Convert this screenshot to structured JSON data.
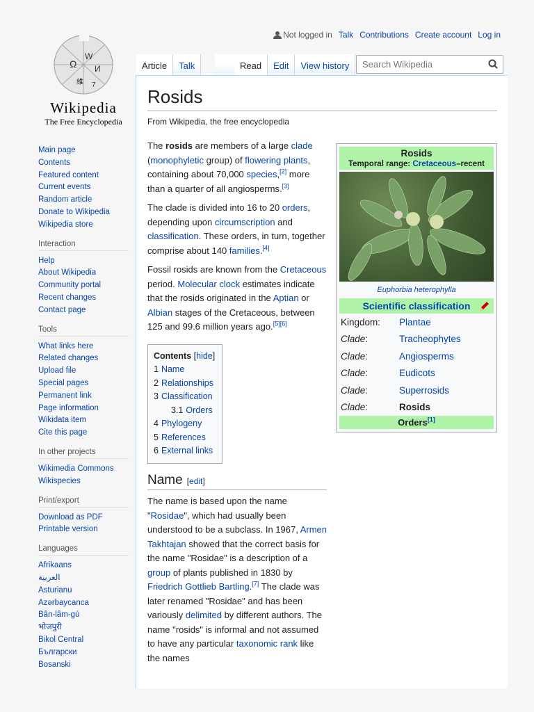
{
  "logo": {
    "wordmark": "Wikipedia",
    "tagline": "The Free Encyclopedia"
  },
  "personal": {
    "status": "Not logged in",
    "links": [
      "Talk",
      "Contributions",
      "Create account",
      "Log in"
    ]
  },
  "tabs": {
    "left": [
      "Article",
      "Talk"
    ],
    "right": [
      "Read",
      "Edit",
      "View history"
    ]
  },
  "search": {
    "placeholder": "Search Wikipedia"
  },
  "title": "Rosids",
  "subtitle": "From Wikipedia, the free encyclopedia",
  "paragraphs": [
    [
      {
        "t": "The "
      },
      {
        "t": "rosids",
        "b": 1
      },
      {
        "t": " are members of a large "
      },
      {
        "t": "clade",
        "l": 1
      },
      {
        "t": " ("
      },
      {
        "t": "monophyletic",
        "l": 1
      },
      {
        "t": " group) of "
      },
      {
        "t": "flowering plants",
        "l": 1
      },
      {
        "t": ", containing about 70,000 "
      },
      {
        "t": "species",
        "l": 1
      },
      {
        "t": ",",
        "n": 0
      },
      {
        "t": "[2]",
        "s": 1
      },
      {
        "t": " more than a quarter of all angiosperms."
      },
      {
        "t": "[3]",
        "s": 1
      }
    ],
    [
      {
        "t": "The clade is divided into 16 to 20 "
      },
      {
        "t": "orders",
        "l": 1
      },
      {
        "t": ", depending upon "
      },
      {
        "t": "circumscription",
        "l": 1
      },
      {
        "t": " and "
      },
      {
        "t": "classification",
        "l": 1
      },
      {
        "t": ". These orders, in turn, together comprise about 140 "
      },
      {
        "t": "families",
        "l": 1
      },
      {
        "t": "."
      },
      {
        "t": "[4]",
        "s": 1
      }
    ],
    [
      {
        "t": "Fossil rosids are known from the "
      },
      {
        "t": "Cretaceous",
        "l": 1
      },
      {
        "t": " period. "
      },
      {
        "t": "Molecular clock",
        "l": 1
      },
      {
        "t": " estimates indicate that the rosids originated in the "
      },
      {
        "t": "Aptian",
        "l": 1
      },
      {
        "t": " or "
      },
      {
        "t": "Albian",
        "l": 1
      },
      {
        "t": " stages of the Cretaceous, between 125 and 99.6 million years ago."
      },
      {
        "t": "[5][6]",
        "s": 1
      }
    ]
  ],
  "toc": {
    "title": "Contents",
    "hide": "hide",
    "items": [
      {
        "n": "1",
        "t": "Name"
      },
      {
        "n": "2",
        "t": "Relationships"
      },
      {
        "n": "3",
        "t": "Classification"
      },
      {
        "n": "3.1",
        "t": "Orders",
        "sub": 1
      },
      {
        "n": "4",
        "t": "Phylogeny"
      },
      {
        "n": "5",
        "t": "References"
      },
      {
        "n": "6",
        "t": "External links"
      }
    ]
  },
  "name_section": {
    "heading": "Name",
    "edit": "edit",
    "paragraph": [
      {
        "t": "The name is based upon the name \""
      },
      {
        "t": "Rosidae",
        "l": 1
      },
      {
        "t": "\", which had usually been understood to be a subclass. In 1967, "
      },
      {
        "t": "Armen Takhtajan",
        "l": 1
      },
      {
        "t": " showed that the correct basis for the name \"Rosidae\" is a description of a "
      },
      {
        "t": "group",
        "l": 1
      },
      {
        "t": " of plants published in 1830 by "
      },
      {
        "t": "Friedrich Gottlieb Bartling",
        "l": 1
      },
      {
        "t": "."
      },
      {
        "t": "[7]",
        "s": 1
      },
      {
        "t": " The clade was later renamed \"Rosidae\" and has been variously "
      },
      {
        "t": "delimited",
        "l": 1
      },
      {
        "t": " by different authors. The name \"rosids\" is informal and not assumed to have any particular "
      },
      {
        "t": "taxonomic rank",
        "l": 1
      },
      {
        "t": " like the names"
      }
    ]
  },
  "infobox": {
    "title": "Rosids",
    "range_label": "Temporal range: ",
    "range_link": "Cretaceous",
    "range_end": "–recent",
    "caption": "Euphorbia heterophylla",
    "sci": "Scientific classification",
    "rows": [
      {
        "k": "Kingdom:",
        "v": "Plantae",
        "l": 1
      },
      {
        "k": "Clade",
        "v": "Tracheophytes",
        "l": 1,
        "i": 1
      },
      {
        "k": "Clade",
        "v": "Angiosperms",
        "l": 1,
        "i": 1
      },
      {
        "k": "Clade",
        "v": "Eudicots",
        "l": 1,
        "i": 1
      },
      {
        "k": "Clade",
        "v": "Superrosids",
        "l": 1,
        "i": 1
      },
      {
        "k": "Clade",
        "v": "Rosids",
        "l": 0,
        "i": 1
      }
    ],
    "orders": "Orders",
    "orders_ref": "[1]"
  },
  "sidebar": {
    "main": [
      "Main page",
      "Contents",
      "Featured content",
      "Current events",
      "Random article",
      "Donate to Wikipedia",
      "Wikipedia store"
    ],
    "sections": [
      {
        "h": "Interaction",
        "items": [
          "Help",
          "About Wikipedia",
          "Community portal",
          "Recent changes",
          "Contact page"
        ]
      },
      {
        "h": "Tools",
        "items": [
          "What links here",
          "Related changes",
          "Upload file",
          "Special pages",
          "Permanent link",
          "Page information",
          "Wikidata item",
          "Cite this page"
        ]
      },
      {
        "h": "In other projects",
        "items": [
          "Wikimedia Commons",
          "Wikispecies"
        ]
      },
      {
        "h": "Print/export",
        "items": [
          "Download as PDF",
          "Printable version"
        ]
      },
      {
        "h": "Languages",
        "items": [
          "Afrikaans",
          "العربية",
          "Asturianu",
          "Azərbaycanca",
          "Bân-lâm-gú",
          "भोजपुरी",
          "Bikol Central",
          "Български",
          "Bosanski"
        ]
      }
    ]
  },
  "colors": {
    "link": "#0645ad",
    "infobox_header": "#b1f2a9"
  }
}
